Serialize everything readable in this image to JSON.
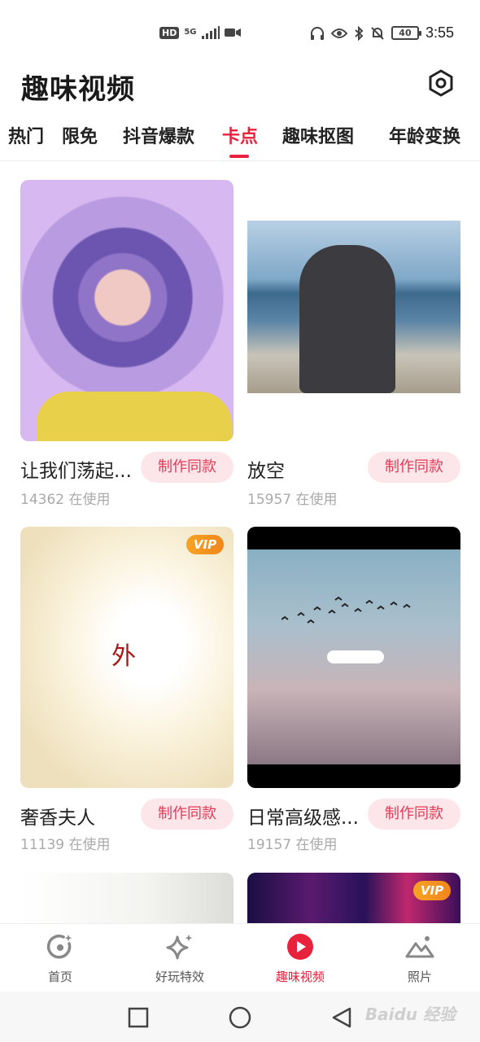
{
  "status_bar": {
    "left_badges": [
      "HD",
      "5G"
    ],
    "battery": "40",
    "time": "3:55"
  },
  "header": {
    "title": "趣味视频",
    "settings_icon": "settings-hexagon-icon"
  },
  "tabs": [
    {
      "label": "热门"
    },
    {
      "label": "限免"
    },
    {
      "label": "抖音爆款"
    },
    {
      "label": "卡点",
      "active": true
    },
    {
      "label": "趣味抠图"
    },
    {
      "label": "年龄变换"
    }
  ],
  "cards": [
    {
      "title": "让我们荡起...",
      "usage": "14362 在使用",
      "button": "制作同款",
      "vip": ""
    },
    {
      "title": "放空",
      "usage": "15957 在使用",
      "button": "制作同款",
      "vip": ""
    },
    {
      "title": "奢香夫人",
      "usage": "11139 在使用",
      "button": "制作同款",
      "vip": "VIP",
      "thumb_text": "外"
    },
    {
      "title": "日常高级感...",
      "usage": "19157 在使用",
      "button": "制作同款",
      "vip": ""
    },
    {
      "vip": ""
    },
    {
      "vip": "VIP"
    }
  ],
  "bottom_nav": [
    {
      "label": "首页",
      "icon": "home-circle-icon"
    },
    {
      "label": "好玩特效",
      "icon": "sparkle-icon"
    },
    {
      "label": "趣味视频",
      "icon": "video-play-icon",
      "active": true
    },
    {
      "label": "照片",
      "icon": "photo-mountain-icon"
    }
  ],
  "system_nav": {
    "watermark": "Baidu 经验"
  },
  "colors": {
    "accent": "#e8223c",
    "button_bg": "#fde6ea",
    "vip": "#f29420"
  }
}
